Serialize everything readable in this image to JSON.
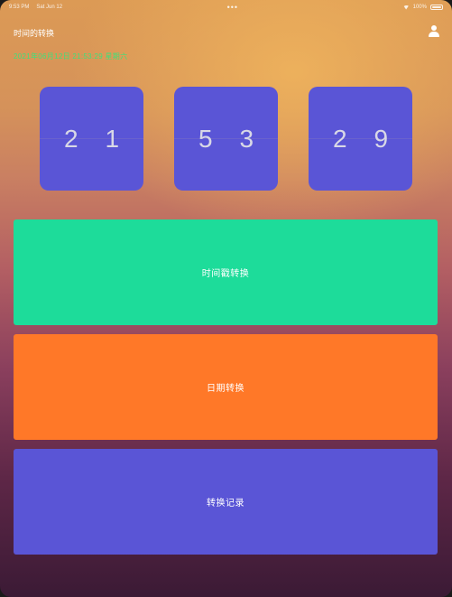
{
  "status_bar": {
    "time": "9:53 PM",
    "date": "Sat Jun 12",
    "dots": "•••",
    "battery": "100%"
  },
  "header": {
    "title": "时间的转换",
    "subtitle": "2021年06月12日 21:53:29 星期六"
  },
  "clock": {
    "groups": [
      {
        "d1": "2",
        "d2": "1"
      },
      {
        "d1": "5",
        "d2": "3"
      },
      {
        "d1": "2",
        "d2": "9"
      }
    ]
  },
  "buttons": {
    "timestamp": "时间戳转换",
    "date": "日期转换",
    "history": "转换记录"
  },
  "colors": {
    "card": "#5a55d6",
    "timestamp_button": "#1ddc9a",
    "date_button": "#ff7828",
    "history_button": "#5a55d6",
    "subtitle": "#3fe07a"
  }
}
